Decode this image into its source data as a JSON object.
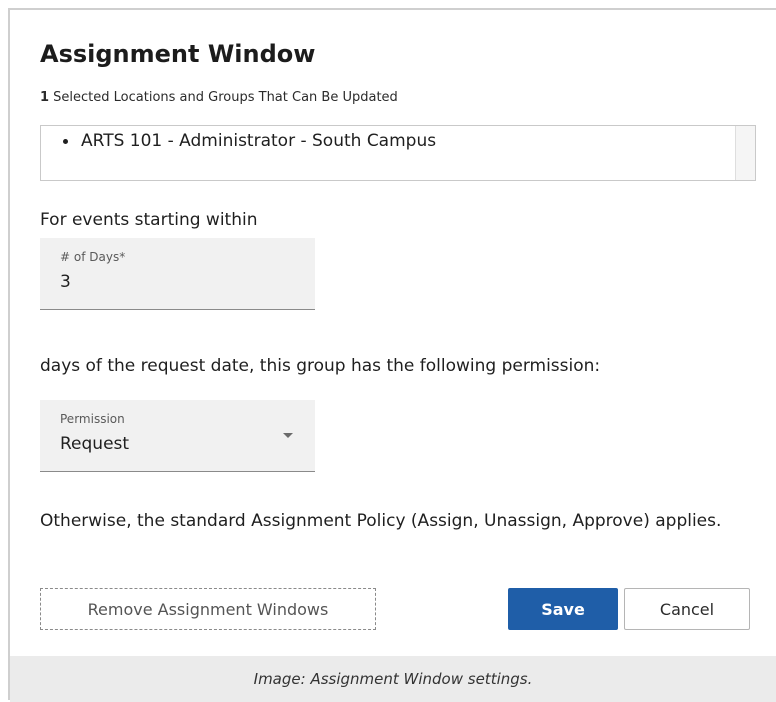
{
  "dialog": {
    "title": "Assignment Window",
    "selected_count": "1",
    "selected_caption": " Selected Locations and Groups That Can Be Updated",
    "selected_items": [
      "ARTS 101 - Administrator - South Campus"
    ],
    "events_within_label": "For events starting within",
    "days_field": {
      "label": "# of Days*",
      "value": "3"
    },
    "days_of_request_text": "days of the request date, this group has the following permission:",
    "permission_field": {
      "label": "Permission",
      "value": "Request"
    },
    "otherwise_text": "Otherwise, the standard Assignment Policy (Assign, Unassign, Approve) applies.",
    "buttons": {
      "remove": "Remove Assignment Windows",
      "save": "Save",
      "cancel": "Cancel"
    },
    "colors": {
      "save_bg": "#1f5ea8",
      "caption_bg": "#ebebeb"
    }
  },
  "caption": "Image: Assignment Window settings."
}
